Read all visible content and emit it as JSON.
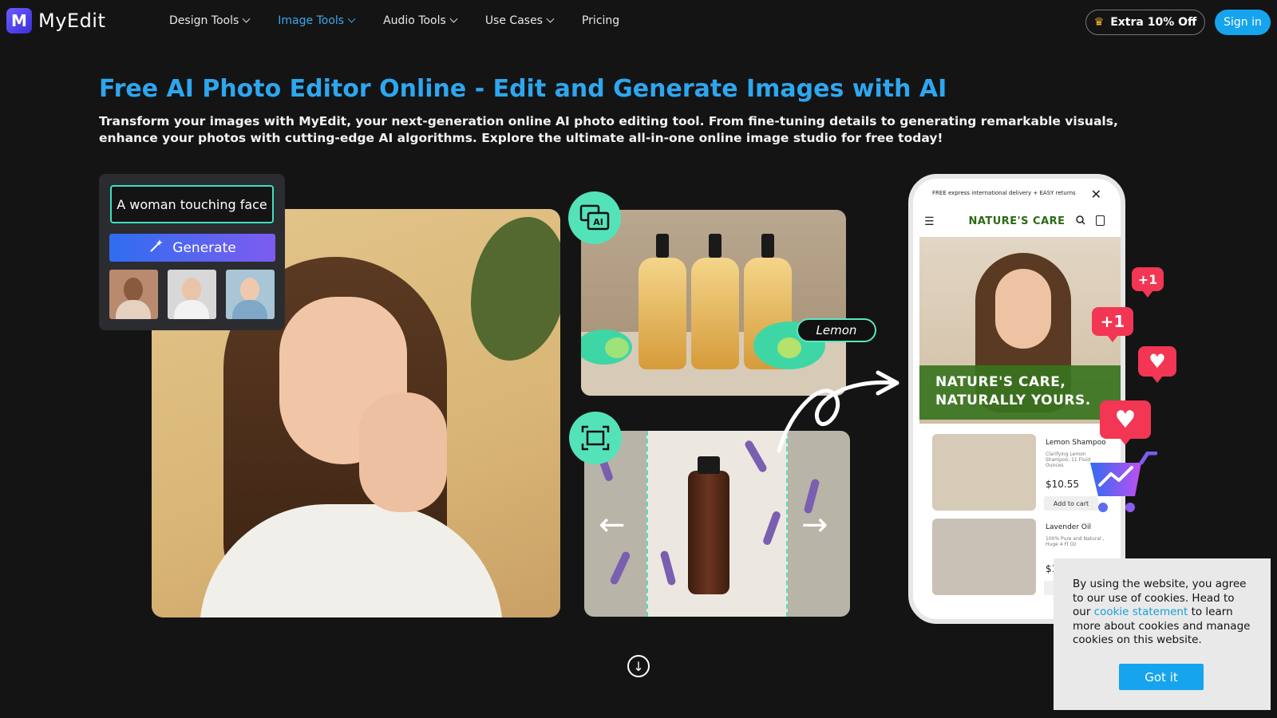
{
  "header": {
    "logo_mark": "M",
    "logo_text": "MyEdit",
    "nav": [
      {
        "label": "Design Tools"
      },
      {
        "label": "Image Tools"
      },
      {
        "label": "Audio Tools"
      },
      {
        "label": "Use Cases"
      },
      {
        "label": "Pricing"
      }
    ],
    "promo_label": "Extra 10% Off",
    "signin_label": "Sign in"
  },
  "hero": {
    "title": "Free AI Photo Editor Online - Edit and Generate Images with AI",
    "description": "Transform your images with MyEdit, your next-generation online AI photo editing tool. From fine-tuning details to generating remarkable visuals, enhance your photos with cutting-edge AI algorithms. Explore the ultimate all-in-one online image studio for free today!"
  },
  "generator": {
    "prompt_value": "A woman touching face",
    "generate_label": "Generate"
  },
  "showcase": {
    "ai_icon_label": "AI",
    "lemon_tag": "Lemon"
  },
  "phone": {
    "top_banner": "FREE express international delivery + EASY returns",
    "brand": "NATURE'S CARE",
    "hero_line1": "NATURE'S CARE,",
    "hero_line2": "NATURALLY YOURS.",
    "products": [
      {
        "name": "Lemon Shampoo",
        "desc": "Clarifying Lemon Shampoo, 11 Fluid Ounces",
        "price": "$10.55",
        "button": "Add to cart"
      },
      {
        "name": "Lavender Oil",
        "desc": "100% Pure and Natural , Huge 4 Fl Oz",
        "price": "$1",
        "button": "A"
      }
    ]
  },
  "badges": {
    "plus_one_a": "+1",
    "plus_one_b": "+1"
  },
  "cookie": {
    "text_before": "By using the website, you agree to our use of cookies. Head to our ",
    "link": "cookie statement",
    "text_after": " to learn more about cookies and manage cookies on this website.",
    "button": "Got it"
  },
  "colors": {
    "accent_blue": "#16a4ee",
    "title_blue": "#2ea6ef",
    "mint": "#54e3b8",
    "brand_green": "#2d6a17",
    "badge_red": "#f23653"
  }
}
